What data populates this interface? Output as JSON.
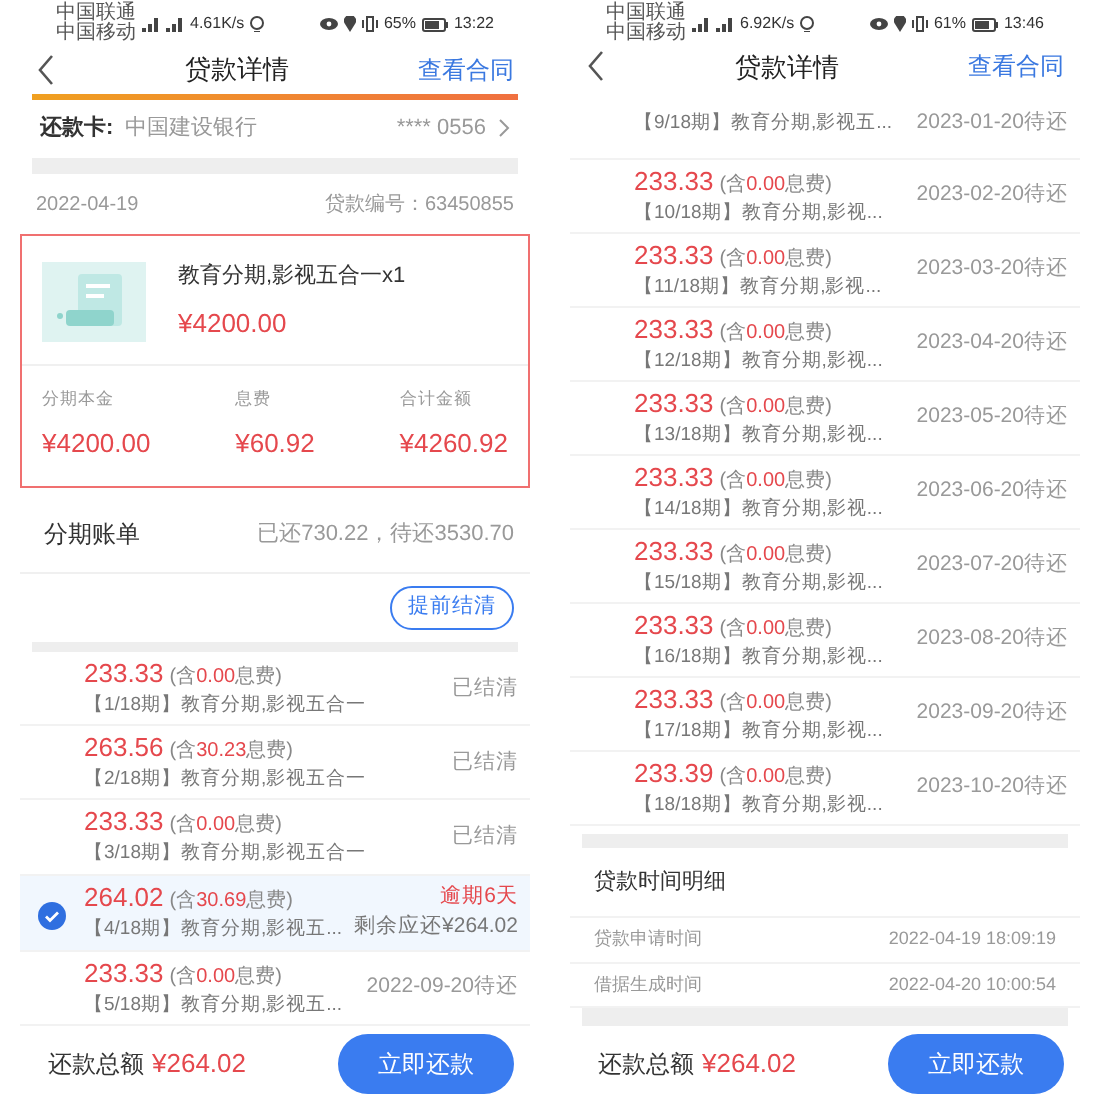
{
  "screens": [
    {
      "status_bar": {
        "carriers": [
          "中国联通",
          "中国移动"
        ],
        "speed": "4.61K/s",
        "battery": "65%",
        "time": "13:22"
      },
      "nav": {
        "title": "贷款详情",
        "action": "查看合同",
        "accent_bar": true
      },
      "repay_card": {
        "label": "还款卡:",
        "bank": "中国建设银行",
        "number": "**** 0556"
      },
      "loan": {
        "date": "2022-04-19",
        "loan_no": "贷款编号：63450855",
        "product": {
          "title": "教育分期,影视五合一x1",
          "price": "¥4200.00",
          "summary": [
            {
              "label": "分期本金",
              "value": "¥4200.00"
            },
            {
              "label": "息费",
              "value": "¥60.92"
            },
            {
              "label": "合计金额",
              "value": "¥4260.92"
            }
          ]
        }
      },
      "bill": {
        "title": "分期账单",
        "summary": "已还730.22，待还3530.70",
        "button": "提前结清"
      },
      "installments": [
        {
          "amount": "233.33",
          "note_prefix": "(含",
          "interest": "0.00",
          "note_suffix": "息费)",
          "name": "【1/18期】教育分期,影视五合一",
          "kind": "settled",
          "status": "已结清",
          "selected": false
        },
        {
          "amount": "263.56",
          "note_prefix": "(含",
          "interest": "30.23",
          "note_suffix": "息费)",
          "name": "【2/18期】教育分期,影视五合一",
          "kind": "settled",
          "status": "已结清",
          "selected": false
        },
        {
          "amount": "233.33",
          "note_prefix": "(含",
          "interest": "0.00",
          "note_suffix": "息费)",
          "name": "【3/18期】教育分期,影视五合一",
          "kind": "settled",
          "status": "已结清",
          "selected": false
        },
        {
          "amount": "264.02",
          "note_prefix": "(含",
          "interest": "30.69",
          "note_suffix": "息费)",
          "name": "【4/18期】教育分期,影视五...",
          "kind": "overdue",
          "status": "逾期6天",
          "remaining": "剩余应还¥264.02",
          "selected": true
        },
        {
          "amount": "233.33",
          "note_prefix": "(含",
          "interest": "0.00",
          "note_suffix": "息费)",
          "name": "【5/18期】教育分期,影视五...",
          "kind": "pending",
          "status": "2022-09-20待还",
          "selected": false
        }
      ],
      "footer": {
        "label": "还款总额",
        "amount": "¥264.02",
        "button": "立即还款"
      }
    },
    {
      "status_bar": {
        "carriers": [
          "中国联通",
          "中国移动"
        ],
        "speed": "6.92K/s",
        "battery": "61%",
        "time": "13:46"
      },
      "nav": {
        "title": "贷款详情",
        "action": "查看合同",
        "accent_bar": false
      },
      "installments": [
        {
          "name": "【9/18期】教育分期,影视五...",
          "kind": "pending",
          "status": "2023-01-20待还",
          "selected": false
        },
        {
          "amount": "233.33",
          "note_prefix": "(含",
          "interest": "0.00",
          "note_suffix": "息费)",
          "name": "【10/18期】教育分期,影视...",
          "kind": "pending",
          "status": "2023-02-20待还",
          "selected": false
        },
        {
          "amount": "233.33",
          "note_prefix": "(含",
          "interest": "0.00",
          "note_suffix": "息费)",
          "name": "【11/18期】教育分期,影视...",
          "kind": "pending",
          "status": "2023-03-20待还",
          "selected": false
        },
        {
          "amount": "233.33",
          "note_prefix": "(含",
          "interest": "0.00",
          "note_suffix": "息费)",
          "name": "【12/18期】教育分期,影视...",
          "kind": "pending",
          "status": "2023-04-20待还",
          "selected": false
        },
        {
          "amount": "233.33",
          "note_prefix": "(含",
          "interest": "0.00",
          "note_suffix": "息费)",
          "name": "【13/18期】教育分期,影视...",
          "kind": "pending",
          "status": "2023-05-20待还",
          "selected": false
        },
        {
          "amount": "233.33",
          "note_prefix": "(含",
          "interest": "0.00",
          "note_suffix": "息费)",
          "name": "【14/18期】教育分期,影视...",
          "kind": "pending",
          "status": "2023-06-20待还",
          "selected": false
        },
        {
          "amount": "233.33",
          "note_prefix": "(含",
          "interest": "0.00",
          "note_suffix": "息费)",
          "name": "【15/18期】教育分期,影视...",
          "kind": "pending",
          "status": "2023-07-20待还",
          "selected": false
        },
        {
          "amount": "233.33",
          "note_prefix": "(含",
          "interest": "0.00",
          "note_suffix": "息费)",
          "name": "【16/18期】教育分期,影视...",
          "kind": "pending",
          "status": "2023-08-20待还",
          "selected": false
        },
        {
          "amount": "233.33",
          "note_prefix": "(含",
          "interest": "0.00",
          "note_suffix": "息费)",
          "name": "【17/18期】教育分期,影视...",
          "kind": "pending",
          "status": "2023-09-20待还",
          "selected": false
        },
        {
          "amount": "233.39",
          "note_prefix": "(含",
          "interest": "0.00",
          "note_suffix": "息费)",
          "name": "【18/18期】教育分期,影视...",
          "kind": "pending",
          "status": "2023-10-20待还",
          "selected": false
        }
      ],
      "time_details": {
        "title": "贷款时间明细",
        "rows": [
          {
            "label": "贷款申请时间",
            "value": "2022-04-19 18:09:19"
          },
          {
            "label": "借据生成时间",
            "value": "2022-04-20 10:00:54"
          }
        ]
      },
      "footer": {
        "label": "还款总额",
        "amount": "¥264.02",
        "button": "立即还款"
      }
    }
  ]
}
